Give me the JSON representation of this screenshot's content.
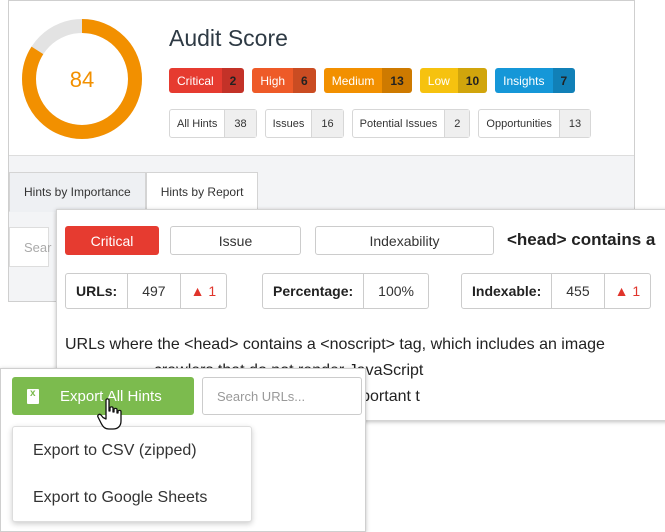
{
  "audit": {
    "score": "84",
    "score_fraction": 0.84,
    "title": "Audit Score",
    "badges": [
      {
        "label": "Critical",
        "count": "2",
        "color": "#e63b30"
      },
      {
        "label": "High",
        "count": "6",
        "color": "#ee5a28"
      },
      {
        "label": "Medium",
        "count": "13",
        "color": "#f29000"
      },
      {
        "label": "Low",
        "count": "10",
        "color": "#f6c20f"
      },
      {
        "label": "Insights",
        "count": "7",
        "color": "#1597d8"
      }
    ],
    "filters": [
      {
        "label": "All Hints",
        "count": "38"
      },
      {
        "label": "Issues",
        "count": "16"
      },
      {
        "label": "Potential Issues",
        "count": "2"
      },
      {
        "label": "Opportunities",
        "count": "13"
      }
    ]
  },
  "tabs": [
    {
      "label": "Hints by Importance",
      "active": true
    },
    {
      "label": "Hints by Report",
      "active": false
    }
  ],
  "back_search": {
    "placeholder": "Sear"
  },
  "hint": {
    "importance": "Critical",
    "type": "Issue",
    "category": "Indexability",
    "title": "<head> contains a",
    "stats": [
      {
        "label": "URLs:",
        "value": "497",
        "delta": "▲ 1"
      },
      {
        "label": "Percentage:",
        "value": "100%"
      },
      {
        "label": "Indexable:",
        "value": "455",
        "delta": "▲ 1"
      }
    ],
    "description_lines": [
      "URLs where the <head> contains a <noscript> tag, which includes an image",
      "                    crawlers that do not render JavaScript",
      "                    <head>, which may cause important t"
    ]
  },
  "export": {
    "button_label": "Export All Hints",
    "search_placeholder": "Search URLs...",
    "menu": [
      "Export to CSV (zipped)",
      "Export to Google Sheets"
    ]
  },
  "colors": {
    "gauge": "#f29000",
    "gauge_track": "#e3e3e3",
    "export_green": "#7cbb4e"
  }
}
